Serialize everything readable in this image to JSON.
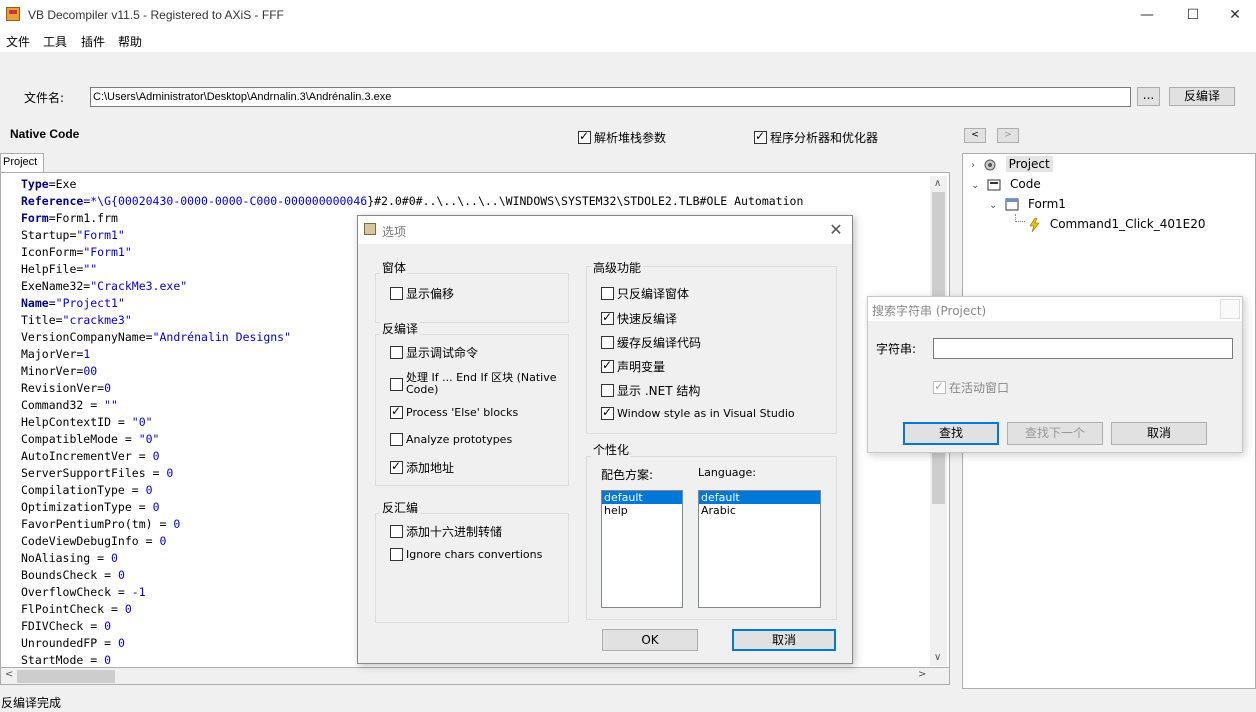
{
  "window": {
    "title": "VB Decompiler v11.5 - Registered to AXiS - FFF",
    "controls": {
      "minimize": "—",
      "maximize": "☐",
      "close": "✕"
    }
  },
  "menu": [
    "文件",
    "工具",
    "插件",
    "帮助"
  ],
  "file": {
    "label": "文件名:",
    "path": "C:\\Users\\Administrator\\Desktop\\Andrnalin.3\\Andrénalin.3.exe",
    "browse_label": "...",
    "decompile_label": "反编译"
  },
  "mode": {
    "label": "Native Code",
    "parse_stack_args": {
      "label": "解析堆栈参数",
      "checked": true
    },
    "analyzer_optimizer": {
      "label": "程序分析器和优化器",
      "checked": true
    },
    "prev": "<",
    "next": ">"
  },
  "project_tab": "Project",
  "code_lines": [
    [
      [
        "Type",
        "kw"
      ],
      [
        "=Exe",
        ""
      ]
    ],
    [
      [
        "Reference",
        "kw"
      ],
      [
        "=*\\G{",
        "str"
      ],
      [
        "00020430-0000-0000-C000-000000000046",
        "num"
      ],
      [
        "}#2.0#0#..\\..\\..\\..\\WINDOWS\\SYSTEM32\\STDOLE2.TLB#OLE Automation",
        ""
      ]
    ],
    [
      [
        "Form",
        "kw"
      ],
      [
        "=Form1.frm",
        ""
      ]
    ],
    [
      [
        "Startup=",
        ""
      ],
      [
        "\"Form1\"",
        "str"
      ]
    ],
    [
      [
        "IconForm=",
        ""
      ],
      [
        "\"Form1\"",
        "str"
      ]
    ],
    [
      [
        "HelpFile=",
        ""
      ],
      [
        "\"\"",
        "str"
      ]
    ],
    [
      [
        "ExeName32=",
        ""
      ],
      [
        "\"CrackMe3.exe\"",
        "str"
      ]
    ],
    [
      [
        "Name",
        "kw"
      ],
      [
        "=",
        ""
      ],
      [
        "\"Project1\"",
        "str"
      ]
    ],
    [
      [
        "Title=",
        ""
      ],
      [
        "\"crackme3\"",
        "str"
      ]
    ],
    [
      [
        "VersionCompanyName=",
        ""
      ],
      [
        "\"Andrénalin Designs\"",
        "str"
      ]
    ],
    [
      [
        "MajorVer=",
        ""
      ],
      [
        "1",
        "num"
      ]
    ],
    [
      [
        "MinorVer=",
        ""
      ],
      [
        "00",
        "num"
      ]
    ],
    [
      [
        "RevisionVer=",
        ""
      ],
      [
        "0",
        "num"
      ]
    ],
    [
      [
        "Command32 = ",
        ""
      ],
      [
        "\"\"",
        "str"
      ]
    ],
    [
      [
        "HelpContextID = ",
        ""
      ],
      [
        "\"0\"",
        "str"
      ]
    ],
    [
      [
        "CompatibleMode = ",
        ""
      ],
      [
        "\"0\"",
        "str"
      ]
    ],
    [
      [
        "AutoIncrementVer = ",
        ""
      ],
      [
        "0",
        "num"
      ]
    ],
    [
      [
        "ServerSupportFiles = ",
        ""
      ],
      [
        "0",
        "num"
      ]
    ],
    [
      [
        "CompilationType = ",
        ""
      ],
      [
        "0",
        "num"
      ]
    ],
    [
      [
        "OptimizationType = ",
        ""
      ],
      [
        "0",
        "num"
      ]
    ],
    [
      [
        "FavorPentiumPro(tm) = ",
        ""
      ],
      [
        "0",
        "num"
      ]
    ],
    [
      [
        "CodeViewDebugInfo = ",
        ""
      ],
      [
        "0",
        "num"
      ]
    ],
    [
      [
        "NoAliasing = ",
        ""
      ],
      [
        "0",
        "num"
      ]
    ],
    [
      [
        "BoundsCheck = ",
        ""
      ],
      [
        "0",
        "num"
      ]
    ],
    [
      [
        "OverflowCheck = ",
        ""
      ],
      [
        "-1",
        "num"
      ]
    ],
    [
      [
        "FlPointCheck = ",
        ""
      ],
      [
        "0",
        "num"
      ]
    ],
    [
      [
        "FDIVCheck = ",
        ""
      ],
      [
        "0",
        "num"
      ]
    ],
    [
      [
        "UnroundedFP = ",
        ""
      ],
      [
        "0",
        "num"
      ]
    ],
    [
      [
        "StartMode = ",
        ""
      ],
      [
        "0",
        "num"
      ]
    ]
  ],
  "tree": {
    "project": "Project",
    "code": "Code",
    "form": "Form1",
    "handler": "Command1_Click_401E20"
  },
  "status": "反编译完成",
  "options_dialog": {
    "title": "选项",
    "groups": {
      "window": {
        "title": "窗体",
        "items": [
          {
            "label": "显示偏移",
            "checked": false
          }
        ]
      },
      "decompile": {
        "title": "反编译",
        "items": [
          {
            "label": "显示调试命令",
            "checked": false
          },
          {
            "label": "处理 If ... End If 区块 (Native Code)",
            "checked": false
          },
          {
            "label": "Process 'Else' blocks",
            "checked": true
          },
          {
            "label": "Analyze prototypes",
            "checked": false
          },
          {
            "label": "添加地址",
            "checked": true
          }
        ]
      },
      "disasm": {
        "title": "反汇编",
        "items": [
          {
            "label": "添加十六进制转储",
            "checked": false
          },
          {
            "label": "Ignore chars convertions",
            "checked": false
          }
        ]
      },
      "advanced": {
        "title": "高级功能",
        "items": [
          {
            "label": "只反编译窗体",
            "checked": false
          },
          {
            "label": "快速反编译",
            "checked": true
          },
          {
            "label": "缓存反编译代码",
            "checked": false
          },
          {
            "label": "声明变量",
            "checked": true
          },
          {
            "label": "显示 .NET 结构",
            "checked": false
          },
          {
            "label": "Window style as in Visual Studio",
            "checked": true
          }
        ]
      },
      "personal": {
        "title": "个性化",
        "color_label": "配色方案:",
        "color_options": [
          "default",
          "help"
        ],
        "language_label": "Language:",
        "language_options": [
          "default",
          "Arabic"
        ]
      }
    },
    "ok": "OK",
    "cancel": "取消"
  },
  "search_dialog": {
    "title": "搜索字符串 (Project)",
    "string_label": "字符串:",
    "string_value": "",
    "active_window": {
      "label": "在活动窗口",
      "checked": true
    },
    "find": "查找",
    "find_next": "查找下一个",
    "cancel": "取消"
  }
}
